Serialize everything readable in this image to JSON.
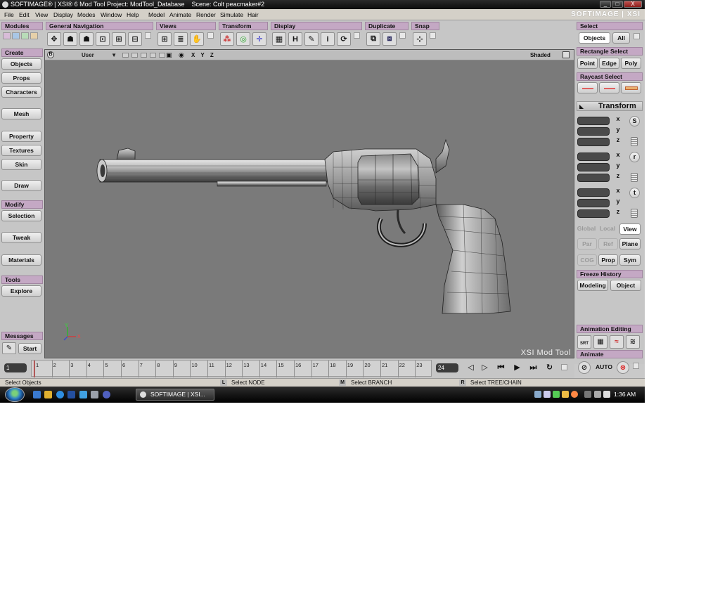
{
  "window": {
    "title": "SOFTIMAGE® | XSI® 6 Mod Tool Project: ModTool_Database    Scene: Colt peacmaker#2",
    "controls": [
      "_",
      "□",
      "X"
    ]
  },
  "menu": {
    "items": [
      "File",
      "Edit",
      "View",
      "Display",
      "Modes",
      "Window",
      "Help",
      "Model",
      "Animate",
      "Render",
      "Simulate",
      "Hair"
    ],
    "brand": "SOFTIMAGE | XSI"
  },
  "toolbar": {
    "modules": "Modules",
    "general_navigation": "General Navigation",
    "views": "Views",
    "transform": "Transform",
    "display": "Display",
    "duplicate": "Duplicate",
    "snap": "Snap",
    "display_h": "H",
    "display_i": "i"
  },
  "left_panel": {
    "create_header": "Create",
    "objects": "Objects",
    "props": "Props",
    "characters": "Characters",
    "mesh": "Mesh",
    "property": "Property",
    "textures": "Textures",
    "skin": "Skin",
    "draw": "Draw",
    "modify_header": "Modify",
    "selection": "Selection",
    "tweak": "Tweak",
    "materials": "Materials",
    "tools_header": "Tools",
    "explore": "Explore",
    "messages_header": "Messages",
    "start": "Start"
  },
  "viewport": {
    "label": "B",
    "camera": "User",
    "axes_label": "X Y Z",
    "shading": "Shaded",
    "watermark": "XSI Mod Tool",
    "axis_x": "X",
    "axis_y": "Y"
  },
  "right_panel": {
    "select_header": "Select",
    "objects": "Objects",
    "all": "All",
    "rect_select_header": "Rectangle Select",
    "point": "Point",
    "edge": "Edge",
    "poly": "Poly",
    "raycast_header": "Raycast Select",
    "transform_title": "Transform",
    "axes": [
      "x",
      "y",
      "z"
    ],
    "scale_btn": "S",
    "rotate_btn": "r",
    "translate_btn": "t",
    "global": "Global",
    "local": "Local",
    "view": "View",
    "par": "Par",
    "ref": "Ref",
    "plane": "Plane",
    "cog": "COG",
    "prop": "Prop",
    "sym": "Sym",
    "freeze_header": "Freeze History",
    "modeling": "Modeling",
    "object": "Object",
    "anim_edit_header": "Animation Editing",
    "srt": "SRT",
    "animate_header": "Animate",
    "auto": "AUTO"
  },
  "timeline": {
    "frame_in": "1",
    "frame_out": "24",
    "ticks": [
      "1",
      "2",
      "3",
      "4",
      "5",
      "6",
      "7",
      "8",
      "9",
      "10",
      "11",
      "12",
      "13",
      "14",
      "15",
      "16",
      "17",
      "18",
      "19",
      "20",
      "21",
      "22",
      "23"
    ]
  },
  "status": {
    "message": "Select Objects",
    "left_key": "L",
    "left_action": "Select NODE",
    "middle_key": "M",
    "middle_action": "Select BRANCH",
    "right_key": "R",
    "right_action": "Select TREE/CHAIN"
  },
  "taskbar": {
    "task": "SOFTIMAGE | XSI...",
    "clock": "1:36 AM"
  },
  "colors": {
    "header_purple": "#c4a8c4",
    "viewport_gray": "#7a7a7a",
    "panel_gray": "#c6c6c6",
    "timeline_cursor": "#e01010"
  }
}
